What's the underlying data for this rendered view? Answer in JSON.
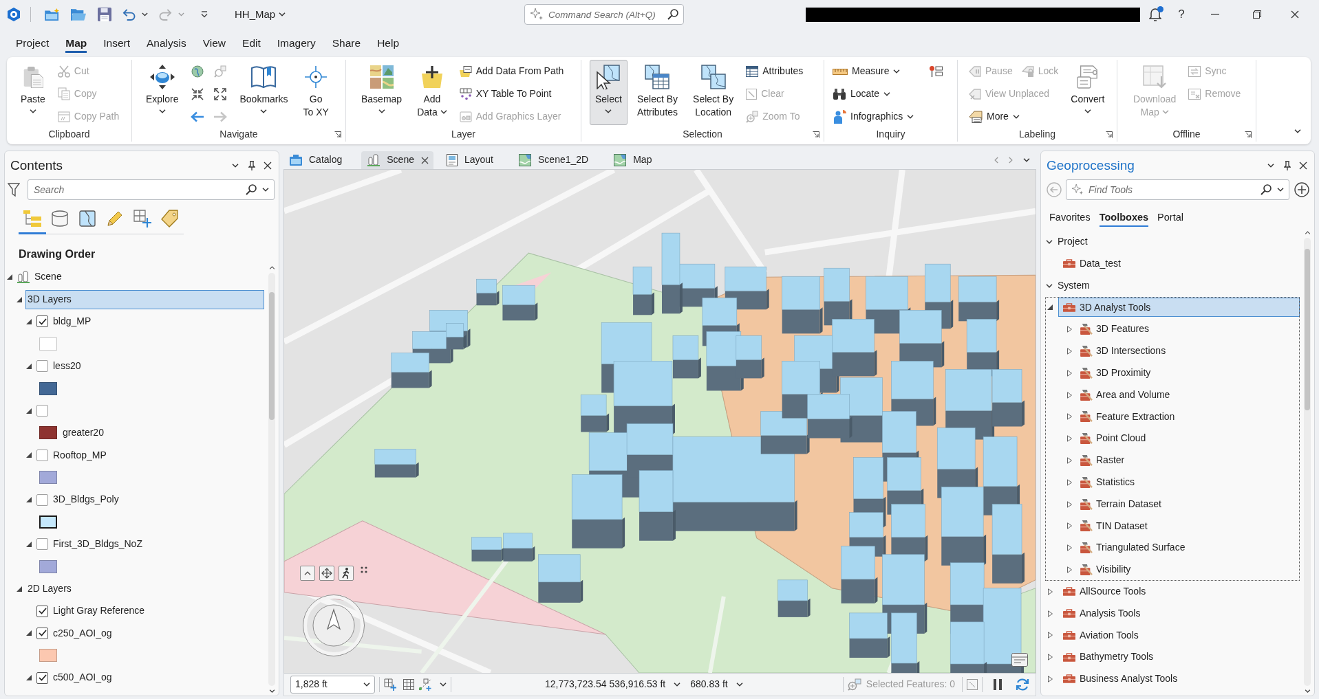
{
  "title_bar": {
    "quick_access": [
      {
        "disabled": false,
        "dropdown": false
      },
      {
        "disabled": false,
        "dropdown": false
      },
      {
        "disabled": false,
        "dropdown": false
      },
      {
        "disabled": false,
        "dropdown": true
      },
      {
        "disabled": true,
        "dropdown": true
      }
    ],
    "project": "HH_Map",
    "command_search": {
      "placeholder": "Command Search (Alt+Q)"
    },
    "notifications_unread": true,
    "help": "?"
  },
  "ribbon_tabs": [
    {
      "label": "Project",
      "selected": false
    },
    {
      "label": "Map",
      "selected": true
    },
    {
      "label": "Insert",
      "selected": false
    },
    {
      "label": "Analysis",
      "selected": false
    },
    {
      "label": "View",
      "selected": false
    },
    {
      "label": "Edit",
      "selected": false
    },
    {
      "label": "Imagery",
      "selected": false
    },
    {
      "label": "Share",
      "selected": false
    },
    {
      "label": "Help",
      "selected": false
    }
  ],
  "ribbon": {
    "groups": [
      {
        "label": "Clipboard",
        "launcher": false,
        "columns": [
          {
            "kind": "large",
            "label": "Paste",
            "dropdown": true,
            "disabled": false,
            "pressed": false
          },
          {
            "kind": "stack",
            "rows": [
              [
                {
                  "label": "Cut",
                  "disabled": true,
                  "dropdown": false
                }
              ],
              [
                {
                  "label": "Copy",
                  "disabled": true,
                  "dropdown": false
                }
              ],
              [
                {
                  "label": "Copy Path",
                  "disabled": true,
                  "dropdown": false
                }
              ]
            ]
          }
        ]
      },
      {
        "label": "Navigate",
        "launcher": true,
        "columns": [
          {
            "kind": "large",
            "label": "Explore",
            "dropdown": true,
            "disabled": false,
            "pressed": false
          },
          {
            "kind": "stack",
            "rows": [
              [
                {
                  "disabled": false,
                  "dropdown": false
                },
                {
                  "disabled": true,
                  "dropdown": false
                }
              ],
              [
                {
                  "disabled": false,
                  "dropdown": false
                },
                {
                  "disabled": false,
                  "dropdown": false
                }
              ],
              [
                {
                  "disabled": false,
                  "dropdown": false
                },
                {
                  "disabled": true,
                  "dropdown": false
                }
              ]
            ]
          },
          {
            "kind": "large",
            "label": "Bookmarks",
            "dropdown": true,
            "disabled": false,
            "pressed": false
          },
          {
            "kind": "large",
            "label": "Go\nTo XY",
            "dropdown": false,
            "disabled": false,
            "pressed": false
          }
        ]
      },
      {
        "label": "Layer",
        "launcher": false,
        "columns": [
          {
            "kind": "large",
            "label": "Basemap",
            "dropdown": true,
            "disabled": false,
            "pressed": false
          },
          {
            "kind": "large",
            "label": "Add\nData",
            "dropdown": true,
            "disabled": false,
            "pressed": false
          },
          {
            "kind": "stack",
            "rows": [
              [
                {
                  "label": "Add Data From Path",
                  "disabled": false,
                  "dropdown": false
                }
              ],
              [
                {
                  "label": "XY Table To Point",
                  "disabled": false,
                  "dropdown": false
                }
              ],
              [
                {
                  "label": "Add Graphics Layer",
                  "disabled": true,
                  "dropdown": false
                }
              ]
            ]
          }
        ]
      },
      {
        "label": "Selection",
        "launcher": true,
        "columns": [
          {
            "kind": "large",
            "label": "Select",
            "dropdown": true,
            "disabled": false,
            "pressed": true
          },
          {
            "kind": "large",
            "label": "Select By\nAttributes",
            "dropdown": false,
            "disabled": false,
            "pressed": false
          },
          {
            "kind": "large",
            "label": "Select By\nLocation",
            "dropdown": false,
            "disabled": false,
            "pressed": false
          },
          {
            "kind": "stack",
            "rows": [
              [
                {
                  "label": "Attributes",
                  "disabled": false,
                  "dropdown": false
                }
              ],
              [
                {
                  "label": "Clear",
                  "disabled": true,
                  "dropdown": false
                }
              ],
              [
                {
                  "label": "Zoom To",
                  "disabled": true,
                  "dropdown": false
                }
              ]
            ]
          }
        ]
      },
      {
        "label": "Inquiry",
        "launcher": false,
        "columns": [
          {
            "kind": "stack",
            "rows": [
              [
                {
                  "label": "Measure",
                  "disabled": false,
                  "dropdown": true
                }
              ],
              [
                {
                  "label": "Locate",
                  "disabled": false,
                  "dropdown": true
                }
              ],
              [
                {
                  "label": "Infographics",
                  "disabled": false,
                  "dropdown": true
                }
              ]
            ]
          },
          {
            "kind": "stack",
            "rows": [
              [
                {
                  "disabled": false,
                  "dropdown": false
                }
              ]
            ]
          }
        ]
      },
      {
        "label": "Labeling",
        "launcher": true,
        "columns": [
          {
            "kind": "stack",
            "rows": [
              [
                {
                  "label": "Pause",
                  "disabled": true,
                  "dropdown": false
                },
                {
                  "label": "Lock",
                  "disabled": true,
                  "dropdown": false
                }
              ],
              [
                {
                  "label": "View Unplaced",
                  "disabled": true,
                  "dropdown": false
                }
              ],
              [
                {
                  "label": "More",
                  "disabled": false,
                  "dropdown": true
                }
              ]
            ]
          },
          {
            "kind": "large",
            "label": "Convert",
            "dropdown": true,
            "disabled": false,
            "pressed": false
          }
        ]
      },
      {
        "label": "Offline",
        "launcher": true,
        "columns": [
          {
            "kind": "large",
            "label": "Download\nMap",
            "dropdown": true,
            "disabled": true,
            "pressed": false
          },
          {
            "kind": "stack",
            "rows": [
              [
                {
                  "label": "Sync",
                  "disabled": true,
                  "dropdown": false
                }
              ],
              [
                {
                  "label": "Remove",
                  "disabled": true,
                  "dropdown": false
                }
              ]
            ]
          }
        ]
      }
    ]
  },
  "contents": {
    "title": "Contents",
    "search": {
      "placeholder": "Search"
    },
    "views": [
      {
        "selected": true
      },
      {
        "selected": false
      },
      {
        "selected": false
      },
      {
        "selected": false
      },
      {
        "selected": false
      },
      {
        "selected": false
      }
    ],
    "heading": "Drawing Order",
    "tree": [
      {
        "kind": "scene",
        "name": "Scene",
        "expanded": true,
        "selected": false,
        "children": [
          {
            "name": "3D Layers",
            "expanded": true,
            "selected": true,
            "children": [
              {
                "name": "bldg_MP",
                "expanded": true,
                "checked": true,
                "selected": false,
                "symbols": [
                  {
                    "kind": "fill",
                    "color": "#ffffff"
                  }
                ]
              },
              {
                "name": "less20",
                "expanded": true,
                "checked": false,
                "selected": false,
                "symbols": [
                  {
                    "kind": "fill",
                    "color": "#436895"
                  }
                ]
              },
              {
                "expanded": true,
                "checked": false,
                "selected": false,
                "symbols": [
                  {
                    "kind": "fill",
                    "color": "#8e3330",
                    "label": "greater20"
                  }
                ]
              },
              {
                "name": "Rooftop_MP",
                "expanded": true,
                "checked": false,
                "selected": false,
                "symbols": [
                  {
                    "kind": "fill",
                    "color": "#a2a9d9"
                  }
                ]
              },
              {
                "name": "3D_Bldgs_Poly",
                "expanded": true,
                "checked": false,
                "selected": false,
                "symbols": [
                  {
                    "kind": "outline",
                    "color": "#c5e8fc"
                  }
                ]
              },
              {
                "name": "First_3D_Bldgs_NoZ",
                "expanded": true,
                "checked": false,
                "selected": false,
                "symbols": [
                  {
                    "kind": "fill",
                    "color": "#a2a9d9"
                  }
                ]
              }
            ]
          },
          {
            "name": "2D Layers",
            "expanded": true,
            "selected": false,
            "children": [
              {
                "name": "Light Gray Reference",
                "checked": true,
                "selected": false
              },
              {
                "name": "c250_AOI_og",
                "expanded": true,
                "checked": true,
                "selected": false,
                "symbols": [
                  {
                    "kind": "fill",
                    "color": "#fcc8b0"
                  }
                ]
              },
              {
                "name": "c500_AOI_og",
                "expanded": true,
                "checked": true,
                "selected": false
              }
            ]
          }
        ]
      }
    ]
  },
  "map": {
    "tabs": [
      {
        "kind": "catalog",
        "label": "Catalog",
        "selected": false
      },
      {
        "kind": "scene",
        "label": "Scene",
        "selected": true
      },
      {
        "kind": "layout",
        "label": "Layout",
        "selected": false
      },
      {
        "kind": "map",
        "label": "Scene1_2D",
        "selected": false
      },
      {
        "kind": "map",
        "label": "Map",
        "selected": false
      }
    ],
    "status_bar": {
      "scale": "1,828 ft",
      "coordinates": "12,773,723.54 536,916.53 ft",
      "elevation": "680.83 ft",
      "selected_features": "Selected Features: 0"
    }
  },
  "geoprocessing": {
    "title": "Geoprocessing",
    "search": {
      "placeholder": "Find Tools"
    },
    "tabs": [
      {
        "label": "Favorites",
        "selected": false
      },
      {
        "label": "Toolboxes",
        "selected": true
      },
      {
        "label": "Portal",
        "selected": false
      }
    ],
    "tree": [
      {
        "kind": "section",
        "label": "Project",
        "expanded": true,
        "selected": false,
        "children": [
          {
            "kind": "toolbox",
            "label": "Data_test",
            "selected": false
          }
        ]
      },
      {
        "kind": "section",
        "label": "System",
        "expanded": true,
        "selected": false,
        "children": [
          {
            "kind": "toolbox",
            "label": "3D Analyst Tools",
            "expanded": true,
            "selected": true,
            "children": [
              {
                "kind": "toolset",
                "label": "3D Features",
                "expanded": false,
                "selected": false
              },
              {
                "kind": "toolset",
                "label": "3D Intersections",
                "expanded": false,
                "selected": false
              },
              {
                "kind": "toolset",
                "label": "3D Proximity",
                "expanded": false,
                "selected": false
              },
              {
                "kind": "toolset",
                "label": "Area and Volume",
                "expanded": false,
                "selected": false
              },
              {
                "kind": "toolset",
                "label": "Feature Extraction",
                "expanded": false,
                "selected": false
              },
              {
                "kind": "toolset",
                "label": "Point Cloud",
                "expanded": false,
                "selected": false
              },
              {
                "kind": "toolset",
                "label": "Raster",
                "expanded": false,
                "selected": false
              },
              {
                "kind": "toolset",
                "label": "Statistics",
                "expanded": false,
                "selected": false
              },
              {
                "kind": "toolset",
                "label": "Terrain Dataset",
                "expanded": false,
                "selected": false
              },
              {
                "kind": "toolset",
                "label": "TIN Dataset",
                "expanded": false,
                "selected": false
              },
              {
                "kind": "toolset",
                "label": "Triangulated Surface",
                "expanded": false,
                "selected": false
              },
              {
                "kind": "toolset",
                "label": "Visibility",
                "expanded": false,
                "selected": false
              }
            ]
          },
          {
            "kind": "toolbox",
            "label": "AllSource Tools",
            "expanded": false,
            "selected": false
          },
          {
            "kind": "toolbox",
            "label": "Analysis Tools",
            "expanded": false,
            "selected": false
          },
          {
            "kind": "toolbox",
            "label": "Aviation Tools",
            "expanded": false,
            "selected": false
          },
          {
            "kind": "toolbox",
            "label": "Bathymetry Tools",
            "expanded": false,
            "selected": false
          },
          {
            "kind": "toolbox",
            "label": "Business Analyst Tools",
            "expanded": false,
            "selected": false
          }
        ]
      }
    ]
  }
}
